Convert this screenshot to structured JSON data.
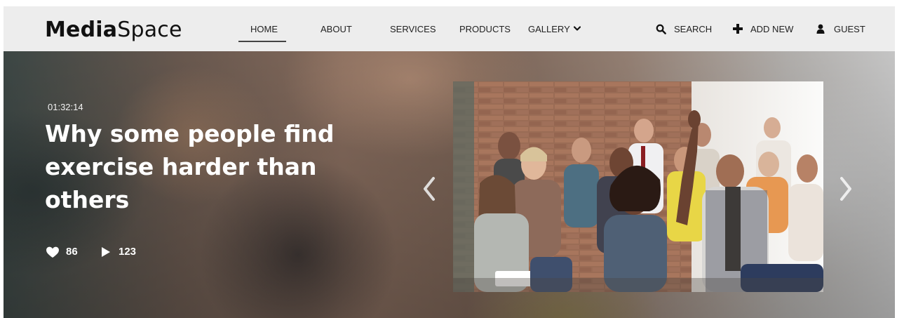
{
  "brand": {
    "bold": "Media",
    "light": "Space"
  },
  "nav": {
    "home": "HOME",
    "about": "ABOUT",
    "services": "SERVICES",
    "products": "PRODUCTS",
    "gallery": "GALLERY"
  },
  "actions": {
    "search": "SEARCH",
    "add_new": "ADD NEW",
    "guest": "GUEST"
  },
  "hero": {
    "duration": "01:32:14",
    "title": "Why some people find exercise harder than others",
    "likes": "86",
    "plays": "123"
  },
  "icons": {
    "gallery_dropdown": "chevron-down-icon",
    "search": "search-icon",
    "add": "plus-icon",
    "user": "user-icon",
    "likes": "heart-icon",
    "plays": "play-icon",
    "prev": "chevron-left-icon",
    "next": "chevron-right-icon"
  },
  "colors": {
    "header_bg": "#ededed",
    "hero_text": "#ffffff"
  }
}
